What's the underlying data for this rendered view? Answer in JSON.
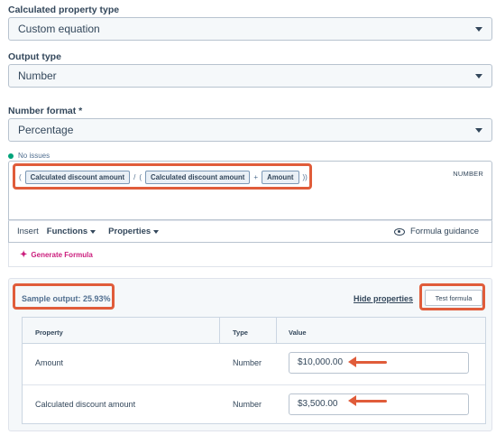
{
  "calculated_property_type": {
    "label": "Calculated property type",
    "value": "Custom equation"
  },
  "output_type": {
    "label": "Output type",
    "value": "Number"
  },
  "number_format": {
    "label": "Number format *",
    "value": "Percentage"
  },
  "formula_editor": {
    "status_text": "No issues",
    "status_color": "#00a37a",
    "result_type": "NUMBER",
    "tokens": {
      "open_paren_1": "(",
      "calc_discount_1": "Calculated discount amount",
      "divide": "/",
      "open_paren_2": "(",
      "calc_discount_2": "Calculated discount amount",
      "plus": "+",
      "amount": "Amount",
      "close_parens": "))"
    }
  },
  "toolbar": {
    "insert_label": "Insert",
    "functions_label": "Functions",
    "properties_label": "Properties",
    "guidance_label": "Formula guidance"
  },
  "generate": {
    "label": "Generate Formula",
    "icon": "sparkle-icon"
  },
  "test_panel": {
    "sample_output": "Sample output: 25.93%",
    "hide_properties": "Hide properties",
    "test_formula": "Test formula",
    "headers": {
      "property": "Property",
      "type": "Type",
      "value": "Value"
    },
    "rows": [
      {
        "property": "Amount",
        "type": "Number",
        "value": "$10,000.00"
      },
      {
        "property": "Calculated discount amount",
        "type": "Number",
        "value": "$3,500.00"
      }
    ]
  },
  "colors": {
    "highlight": "#e05c3a",
    "accent_pink": "#cb1e7d",
    "text": "#33475b"
  }
}
